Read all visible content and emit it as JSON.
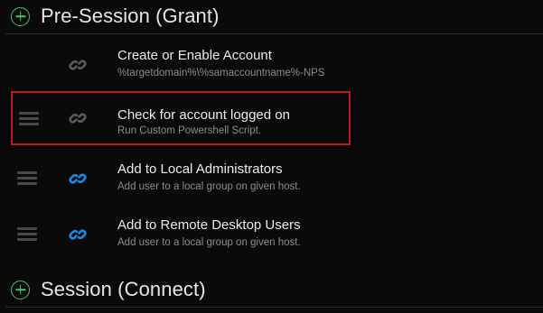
{
  "sections": {
    "pre_session": {
      "title": "Pre-Session (Grant)"
    },
    "session": {
      "title": "Session (Connect)"
    }
  },
  "items": [
    {
      "title": "Create or Enable Account",
      "subtitle": "%targetdomain%\\%samaccountname%-NPS",
      "has_drag_handle": false,
      "icon": "link-icon",
      "icon_color": "#5a5a5a"
    },
    {
      "title": "Check for account logged on",
      "subtitle": "Run Custom Powershell Script.",
      "has_drag_handle": true,
      "icon": "link-icon",
      "icon_color": "#5a5a5a",
      "selected": true
    },
    {
      "title": "Add to Local Administrators",
      "subtitle": "Add user to a local group on given host.",
      "has_drag_handle": true,
      "icon": "link-icon",
      "icon_color": "#1e88e5"
    },
    {
      "title": "Add to Remote Desktop Users",
      "subtitle": "Add user to a local group on given host.",
      "has_drag_handle": true,
      "icon": "link-icon",
      "icon_color": "#1e88e5"
    }
  ],
  "colors": {
    "background": "#0a0a0a",
    "accent_green": "#4fbe6a",
    "highlight_border": "#c0171b",
    "link_active": "#1e88e5",
    "link_inactive": "#5a5a5a"
  }
}
